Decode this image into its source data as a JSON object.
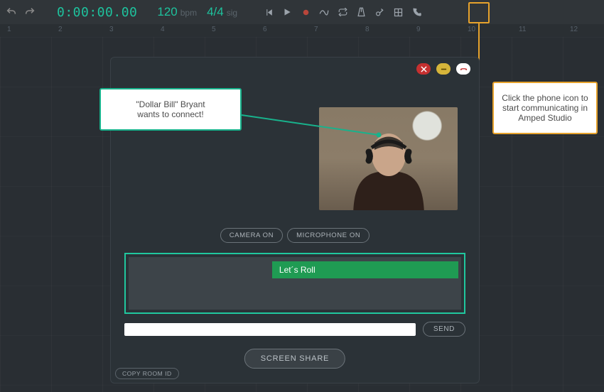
{
  "toolbar": {
    "timer": "0:00:00.00",
    "tempo_value": "120",
    "tempo_unit": "bpm",
    "timesig_value": "4/4",
    "timesig_unit": "sig"
  },
  "ruler": {
    "ticks": [
      "1",
      "2",
      "3",
      "4",
      "5",
      "6",
      "7",
      "8",
      "9",
      "10",
      "11",
      "12"
    ]
  },
  "callout": {
    "line1": "\"Dollar Bill\" Bryant",
    "line2": "wants to connect!"
  },
  "tip": {
    "text": "Click the phone icon to start communicating in Amped Studio"
  },
  "modal": {
    "camera_on": "CAMERA ON",
    "microphone_on": "MICROPHONE ON",
    "chat_message": "Let´s Roll",
    "send": "SEND",
    "screen_share": "SCREEN SHARE",
    "copy_room_id": "COPY ROOM ID"
  }
}
